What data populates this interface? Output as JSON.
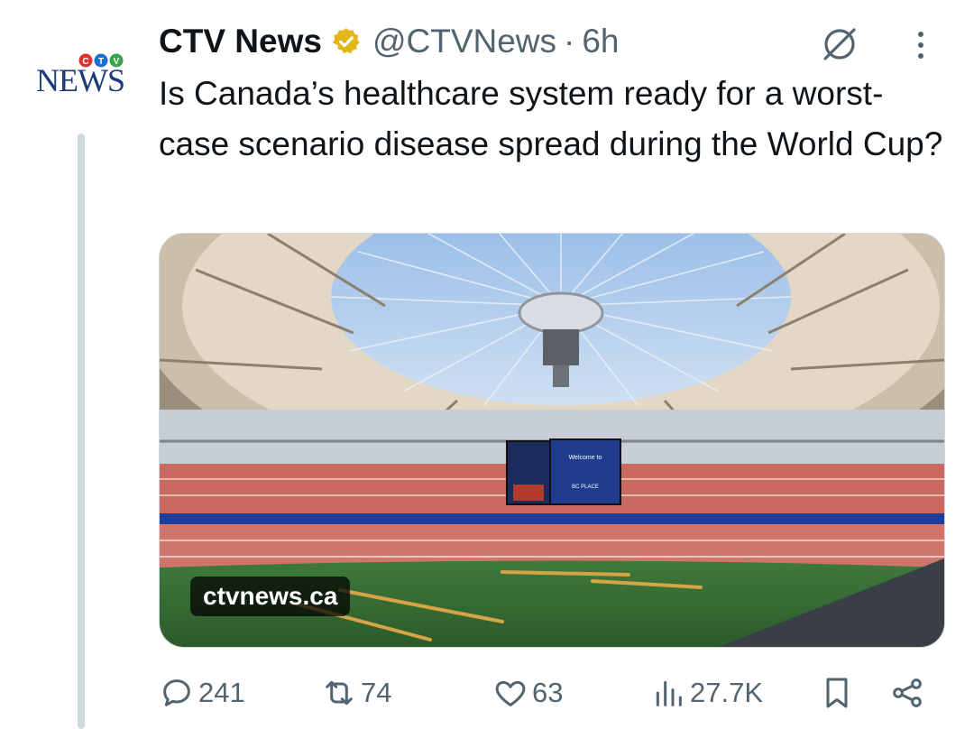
{
  "author": {
    "display_name": "CTV News",
    "handle": "@CTVNews",
    "separator": "·",
    "time": "6h",
    "logo_text": "NEWS",
    "logo_mark": "CTV"
  },
  "tweet": {
    "text": "Is Canada’s healthcare system ready for a worst-case scenario disease spread during the World Cup?"
  },
  "media": {
    "domain": "ctvnews.ca",
    "scoreboard_text": "Welcome to",
    "scoreboard_sub": "BC PLACE"
  },
  "actions": {
    "replies": "241",
    "reposts": "74",
    "likes": "63",
    "views": "27.7K"
  },
  "icons": {
    "verified": "verified-badge-icon",
    "grok": "grok-icon",
    "more": "more-icon",
    "reply": "reply-icon",
    "repost": "repost-icon",
    "like": "heart-icon",
    "views": "views-icon",
    "bookmark": "bookmark-icon",
    "share": "share-icon"
  },
  "colors": {
    "text_primary": "#0f1419",
    "text_secondary": "#536471",
    "verified_gold": "#e2b719",
    "logo_blue": "#1a3a78"
  }
}
